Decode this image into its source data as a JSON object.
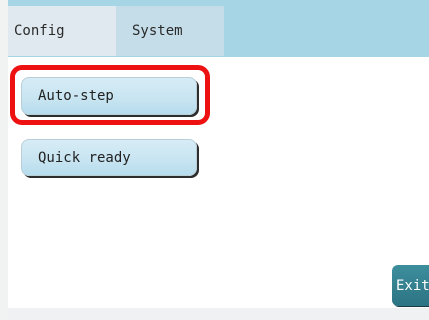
{
  "tabs": {
    "config_label": "Config",
    "system_label": "System"
  },
  "buttons": {
    "auto_step_label": "Auto-step",
    "quick_ready_label": "Quick ready",
    "exit_label": "Exit"
  },
  "colors": {
    "topbar": "#a6d5e6",
    "highlight": "#ee1111",
    "exit_button": "#2c7483"
  }
}
